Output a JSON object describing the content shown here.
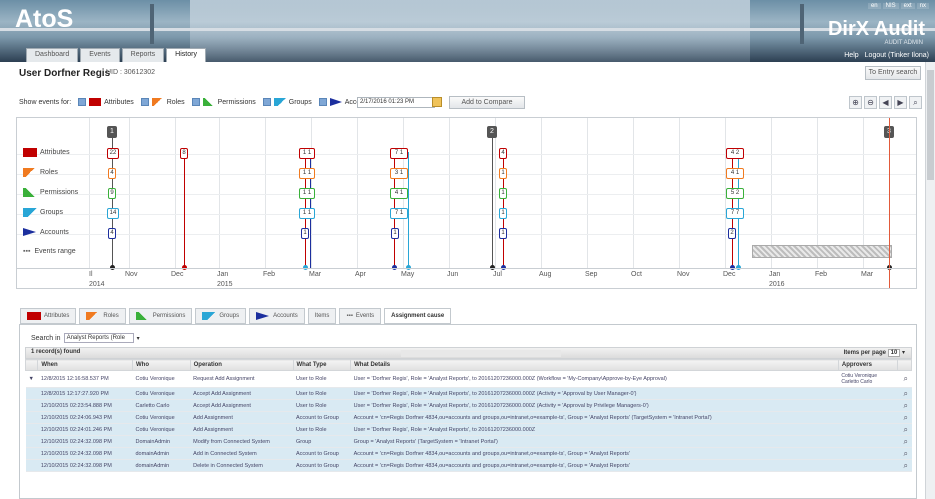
{
  "header": {
    "logo": "AtoS",
    "brand": "DirX Audit",
    "brand_sub": "AUDIT ADMIN",
    "win_buttons": [
      "en",
      "NIS",
      "ext",
      "nx"
    ],
    "help": "Help",
    "logout": "Logout (Tinker Ilona)",
    "tabs": [
      "Dashboard",
      "Events",
      "Reports",
      "History"
    ],
    "active_tab": "History"
  },
  "page": {
    "title": "User Dorfner Regis",
    "uid": "UID : 30612302",
    "to_entry_label": "To Entry search"
  },
  "filter": {
    "show_label": "Show events for:",
    "items": [
      {
        "label": "Attributes",
        "color": "#c00000"
      },
      {
        "label": "Roles",
        "color": "#f07a20"
      },
      {
        "label": "Permissions",
        "color": "#3ab03a"
      },
      {
        "label": "Groups",
        "color": "#29a6d6"
      },
      {
        "label": "Accounts",
        "color": "#1c2f9e"
      }
    ],
    "date_value": "2/17/2016 01:23 PM",
    "add_compare": "Add to Compare",
    "zoom_icons": [
      "zoom-in-icon",
      "zoom-out-icon",
      "back-icon",
      "forward-icon",
      "zoom-fit-icon"
    ]
  },
  "timeline": {
    "rows": [
      {
        "label": "Attributes",
        "color": "#c00000"
      },
      {
        "label": "Roles",
        "color": "#f07a20"
      },
      {
        "label": "Permissions",
        "color": "#3ab03a"
      },
      {
        "label": "Groups",
        "color": "#29a6d6"
      },
      {
        "label": "Accounts",
        "color": "#1c2f9e"
      },
      {
        "label": "Events range",
        "color": "#888888"
      }
    ],
    "months": [
      "Nov",
      "Dec",
      "Jan",
      "Feb",
      "Mar",
      "Apr",
      "May",
      "Jun",
      "Jul",
      "Aug",
      "Sep",
      "Oct",
      "Nov",
      "Dec",
      "Jan",
      "Feb",
      "Mar"
    ],
    "years": [
      "2014",
      "2015",
      "2016"
    ],
    "totals": [
      "1",
      "2",
      "3"
    ],
    "events": [
      {
        "col": 0,
        "attrs": "22",
        "roles": "4",
        "perms": "9",
        "groups": "14",
        "accounts": "4"
      },
      {
        "col": 1,
        "attrs": "8"
      },
      {
        "col": 2,
        "attrs": "1 1",
        "roles": "1 1",
        "perms": "1 1",
        "groups": "1 1",
        "accounts": "1"
      },
      {
        "col": 3,
        "attrs": "7 1",
        "roles": "3 1",
        "perms": "4 1",
        "groups": "7 1",
        "accounts": "1"
      },
      {
        "col": 4,
        "attrs": "4",
        "roles": "1",
        "perms": "1",
        "groups": "1",
        "accounts": "1"
      },
      {
        "col": 5,
        "attrs": "4 2",
        "roles": "4 1",
        "perms": "5 2",
        "groups": "7 7",
        "accounts": "2"
      }
    ]
  },
  "bottom_tabs": [
    "Attributes",
    "Roles",
    "Permissions",
    "Groups",
    "Accounts",
    "Items",
    "Events",
    "Assignment cause"
  ],
  "active_bottom_tab": "Assignment cause",
  "search": {
    "label": "Search in",
    "value": "Analyst Reports (Role"
  },
  "records": {
    "count": "1 record(s) found",
    "items_per_page_label": "Items per page",
    "items_per_page": "10"
  },
  "table": {
    "headers": [
      "When",
      "Who",
      "Operation",
      "What Type",
      "What Details",
      "Approvers"
    ],
    "rows": [
      {
        "when": "12/8/2015 12:16:58.537 PM",
        "who": "Cotiu Veronique",
        "op": "Request Add Assignment",
        "type": "User to Role",
        "details": "User = 'Dorfner Regis', Role = 'Analyst Reports', to 20161207236000.000Z (Workflow = 'My-Company\\Approve-by-Eye Approval)",
        "approvers": "Cotiu Veronique\nCarletto Carlo"
      },
      {
        "when": "12/8/2015 12:17:27.920 PM",
        "who": "Cotiu Veronique",
        "op": "Accept Add Assignment",
        "type": "User to Role",
        "details": "User = 'Dorfner Regis', Role = 'Analyst Reports', to 20161207236000.000Z (Activity = 'Approval by User Manager-0')",
        "approvers": ""
      },
      {
        "when": "12/10/2015 02:23:54.888 PM",
        "who": "Carletto Carlo",
        "op": "Accept Add Assignment",
        "type": "User to Role",
        "details": "User = 'Dorfner Regis', Role = 'Analyst Reports', to 20161207236000.000Z (Activity = 'Approval by Privilege Managers-0')",
        "approvers": ""
      },
      {
        "when": "12/10/2015 02:24:06.943 PM",
        "who": "Cotiu Veronique",
        "op": "Add Assignment",
        "type": "Account to Group",
        "details": "Account = 'cn=Regis Dorfner 4834,ou=accounts and groups,ou=intranet,o=example-ts', Group = 'Analyst Reports' (TargetSystem = 'Intranet Portal')",
        "approvers": ""
      },
      {
        "when": "12/10/2015 02:24:01.246 PM",
        "who": "Cotiu Veronique",
        "op": "Add Assignment",
        "type": "User to Role",
        "details": "User = 'Dorfner Regis', Role = 'Analyst Reports', to 20161207236000.000Z",
        "approvers": ""
      },
      {
        "when": "12/10/2015 02:24:32.098 PM",
        "who": "DomainAdmin",
        "op": "Modify from Connected System",
        "type": "Group",
        "details": "Group = 'Analyst Reports' (TargetSystem = 'Intranet Portal')",
        "approvers": ""
      },
      {
        "when": "12/10/2015 02:24:32.098 PM",
        "who": "domainAdmin",
        "op": "Add in Connected System",
        "type": "Account to Group",
        "details": "Account = 'cn=Regis Dorfner 4834,ou=accounts and groups,ou=intranet,o=example-ts', Group = 'Analyst Reports'",
        "approvers": ""
      },
      {
        "when": "12/10/2015 02:24:32.098 PM",
        "who": "domainAdmin",
        "op": "Delete in Connected System",
        "type": "Account to Group",
        "details": "Account = 'cn=Regis Dorfner 4834,ou=accounts and groups,ou=intranet,o=example-ts', Group = 'Analyst Reports'",
        "approvers": ""
      }
    ]
  }
}
